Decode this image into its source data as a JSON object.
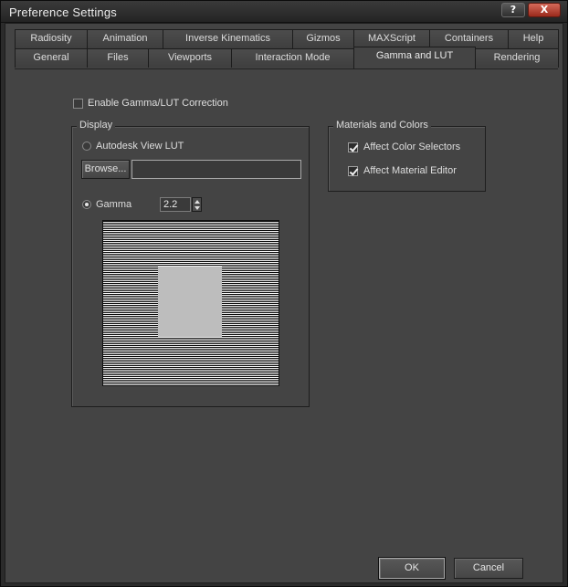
{
  "window": {
    "title": "Preference Settings",
    "help_glyph": "?",
    "close_glyph": "X"
  },
  "tabs": {
    "row1": [
      "Radiosity",
      "Animation",
      "Inverse Kinematics",
      "Gizmos",
      "MAXScript",
      "Containers",
      "Help"
    ],
    "row2": [
      "General",
      "Files",
      "Viewports",
      "Interaction Mode",
      "Gamma and LUT",
      "Rendering"
    ],
    "active": "Gamma and LUT"
  },
  "gamma_lut": {
    "enable_label": "Enable Gamma/LUT Correction",
    "enable_checked": false
  },
  "display": {
    "group_title": "Display",
    "lut_label": "Autodesk View LUT",
    "lut_selected": false,
    "browse_label": "Browse...",
    "lut_path": "",
    "gamma_label": "Gamma",
    "gamma_selected": true,
    "gamma_value": "2.2"
  },
  "materials": {
    "group_title": "Materials and Colors",
    "affect_color_selectors_label": "Affect Color Selectors",
    "affect_color_selectors_checked": true,
    "affect_material_editor_label": "Affect Material Editor",
    "affect_material_editor_checked": true
  },
  "footer": {
    "ok_label": "OK",
    "cancel_label": "Cancel"
  },
  "colors": {
    "background": "#444444",
    "title_bar": "#2b2b2b",
    "close_button": "#b8402e"
  }
}
